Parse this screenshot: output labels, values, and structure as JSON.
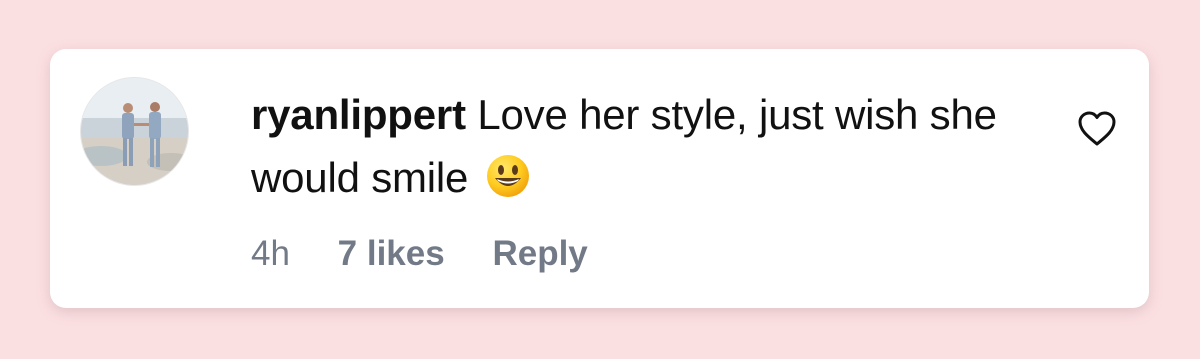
{
  "comment": {
    "username": "ryanlippert",
    "text": "Love her style, just wish she would smile",
    "emoji": "grinning-face-emoji",
    "time": "4h",
    "likes": "7 likes",
    "reply_label": "Reply",
    "like_icon": "heart-outline-icon"
  },
  "colors": {
    "page_background": "#fbe0e2",
    "card_background": "#ffffff",
    "text_primary": "#111111",
    "text_secondary": "#737a87"
  }
}
